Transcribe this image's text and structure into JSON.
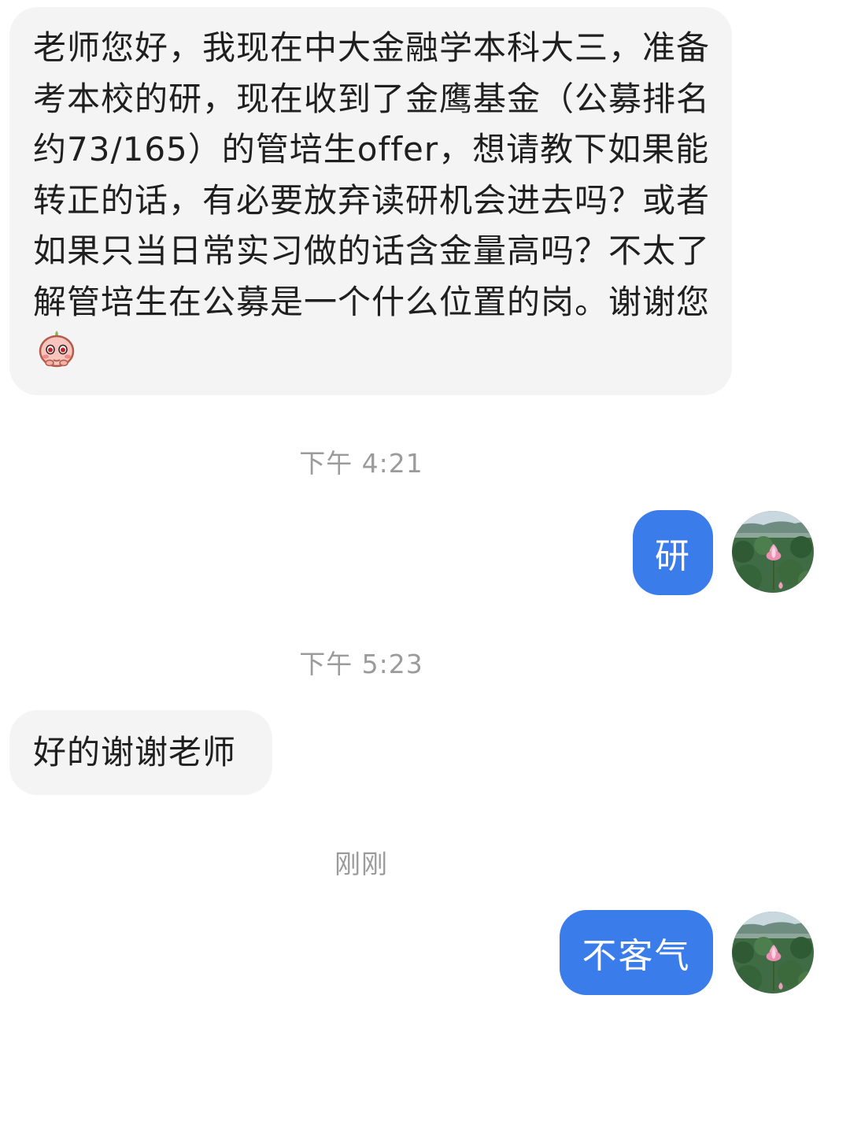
{
  "messages": [
    {
      "direction": "incoming",
      "text": "老师您好，我现在中大金融学本科大三，准备考本校的研，现在收到了金鹰基金（公募排名约73/165）的管培生offer，想请教下如果能转正的话，有必要放弃读研机会进去吗？或者如果只当日常实习做的话含金量高吗？不太了解管培生在公募是一个什么位置的岗。谢谢您",
      "emoji": "blushing-face-emoji"
    },
    {
      "timestamp": "下午 4:21"
    },
    {
      "direction": "outgoing",
      "text": "研",
      "avatar": "lotus-flower-avatar"
    },
    {
      "timestamp": "下午 5:23"
    },
    {
      "direction": "incoming",
      "text": "好的谢谢老师"
    },
    {
      "timestamp": "刚刚"
    },
    {
      "direction": "outgoing",
      "text": "不客气",
      "avatar": "lotus-flower-avatar"
    }
  ],
  "colors": {
    "incoming_bubble": "#f4f4f5",
    "outgoing_bubble": "#3a7dea",
    "timestamp_text": "#9b9b9b",
    "body_text": "#1f1f1f"
  }
}
